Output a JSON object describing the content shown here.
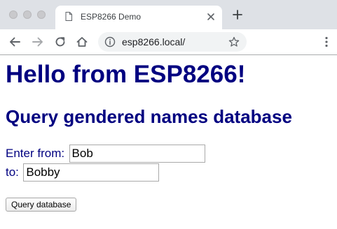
{
  "browser": {
    "tab": {
      "title": "ESP8266 Demo",
      "page_icon": "page-icon",
      "close_icon": "close-icon"
    },
    "new_tab_icon": "plus-icon",
    "toolbar": {
      "back_icon": "arrow-left-icon",
      "forward_icon": "arrow-right-icon",
      "reload_icon": "reload-icon",
      "home_icon": "home-icon",
      "url": "esp8266.local/",
      "info_icon": "info-icon",
      "bookmark_icon": "star-icon",
      "menu_icon": "vertical-dots-icon"
    }
  },
  "page": {
    "heading": "Hello from ESP8266!",
    "subheading": "Query gendered names database",
    "form": {
      "from_label": "Enter from:",
      "from_value": "Bob",
      "to_label": "to:",
      "to_value": "Bobby",
      "submit_label": "Query database"
    },
    "text_color": "#000080"
  }
}
